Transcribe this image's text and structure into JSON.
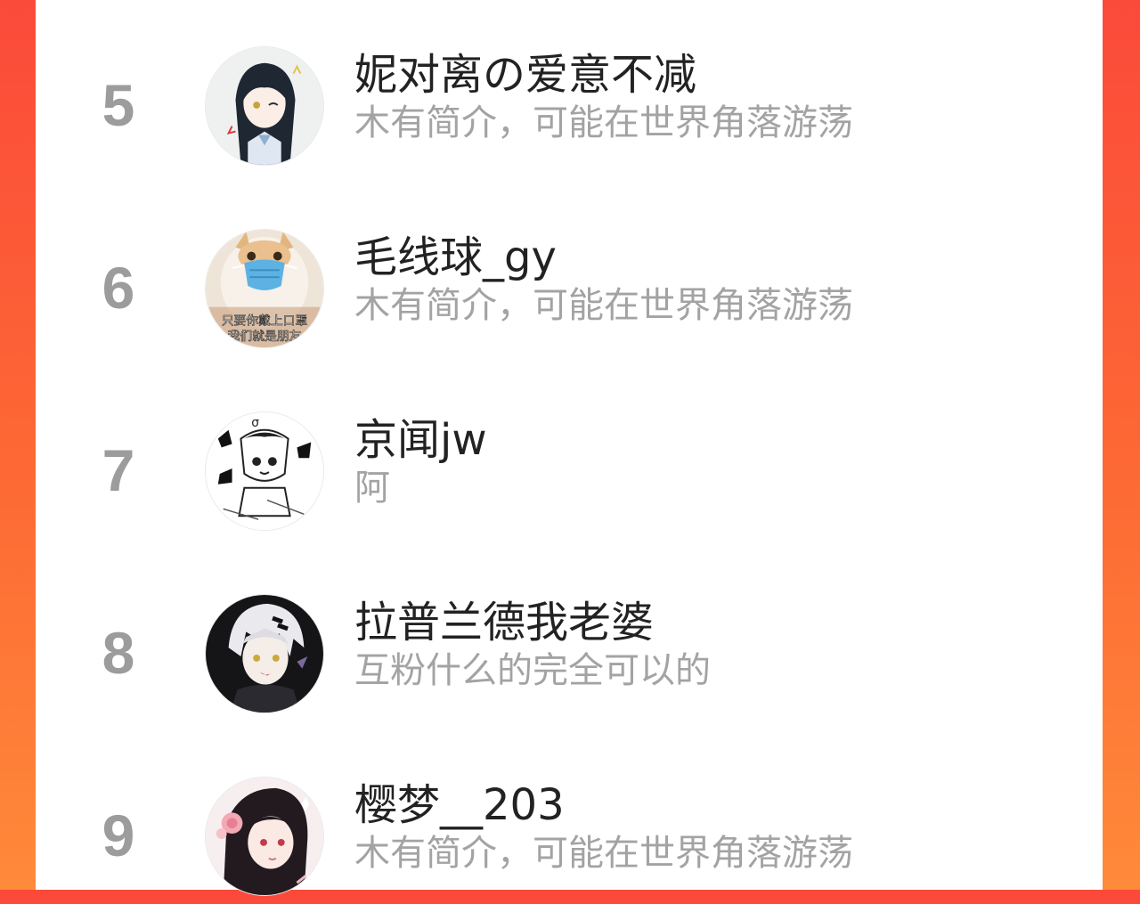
{
  "colors": {
    "background_gradient_top": "#fb4a3a",
    "background_gradient_bottom": "#ff8a3a",
    "panel": "#ffffff",
    "rank": "#9c9c9c",
    "name": "#222222",
    "bio": "#a3a3a3"
  },
  "ranking": {
    "items": [
      {
        "rank": "5",
        "name": "妮对离の爱意不减",
        "bio": "木有简介，可能在世界角落游荡",
        "avatar": {
          "description": "anime girl avatar",
          "caption_lines": []
        }
      },
      {
        "rank": "6",
        "name": "毛线球_gy",
        "bio": "木有简介，可能在世界角落游荡",
        "avatar": {
          "description": "cat with mask avatar",
          "caption_lines": [
            "只要你戴上口罩",
            "我们就是朋友"
          ]
        }
      },
      {
        "rank": "7",
        "name": "京闻jw",
        "bio": "阿",
        "avatar": {
          "description": "manga sketch avatar",
          "caption_lines": []
        }
      },
      {
        "rank": "8",
        "name": "拉普兰德我老婆",
        "bio": "互粉什么的完全可以的",
        "avatar": {
          "description": "white-haired anime avatar",
          "caption_lines": []
        }
      },
      {
        "rank": "9",
        "name": "樱梦__203",
        "bio": "木有简介，可能在世界角落游荡",
        "avatar": {
          "description": "anime girl with flower avatar",
          "caption_lines": []
        }
      }
    ]
  }
}
